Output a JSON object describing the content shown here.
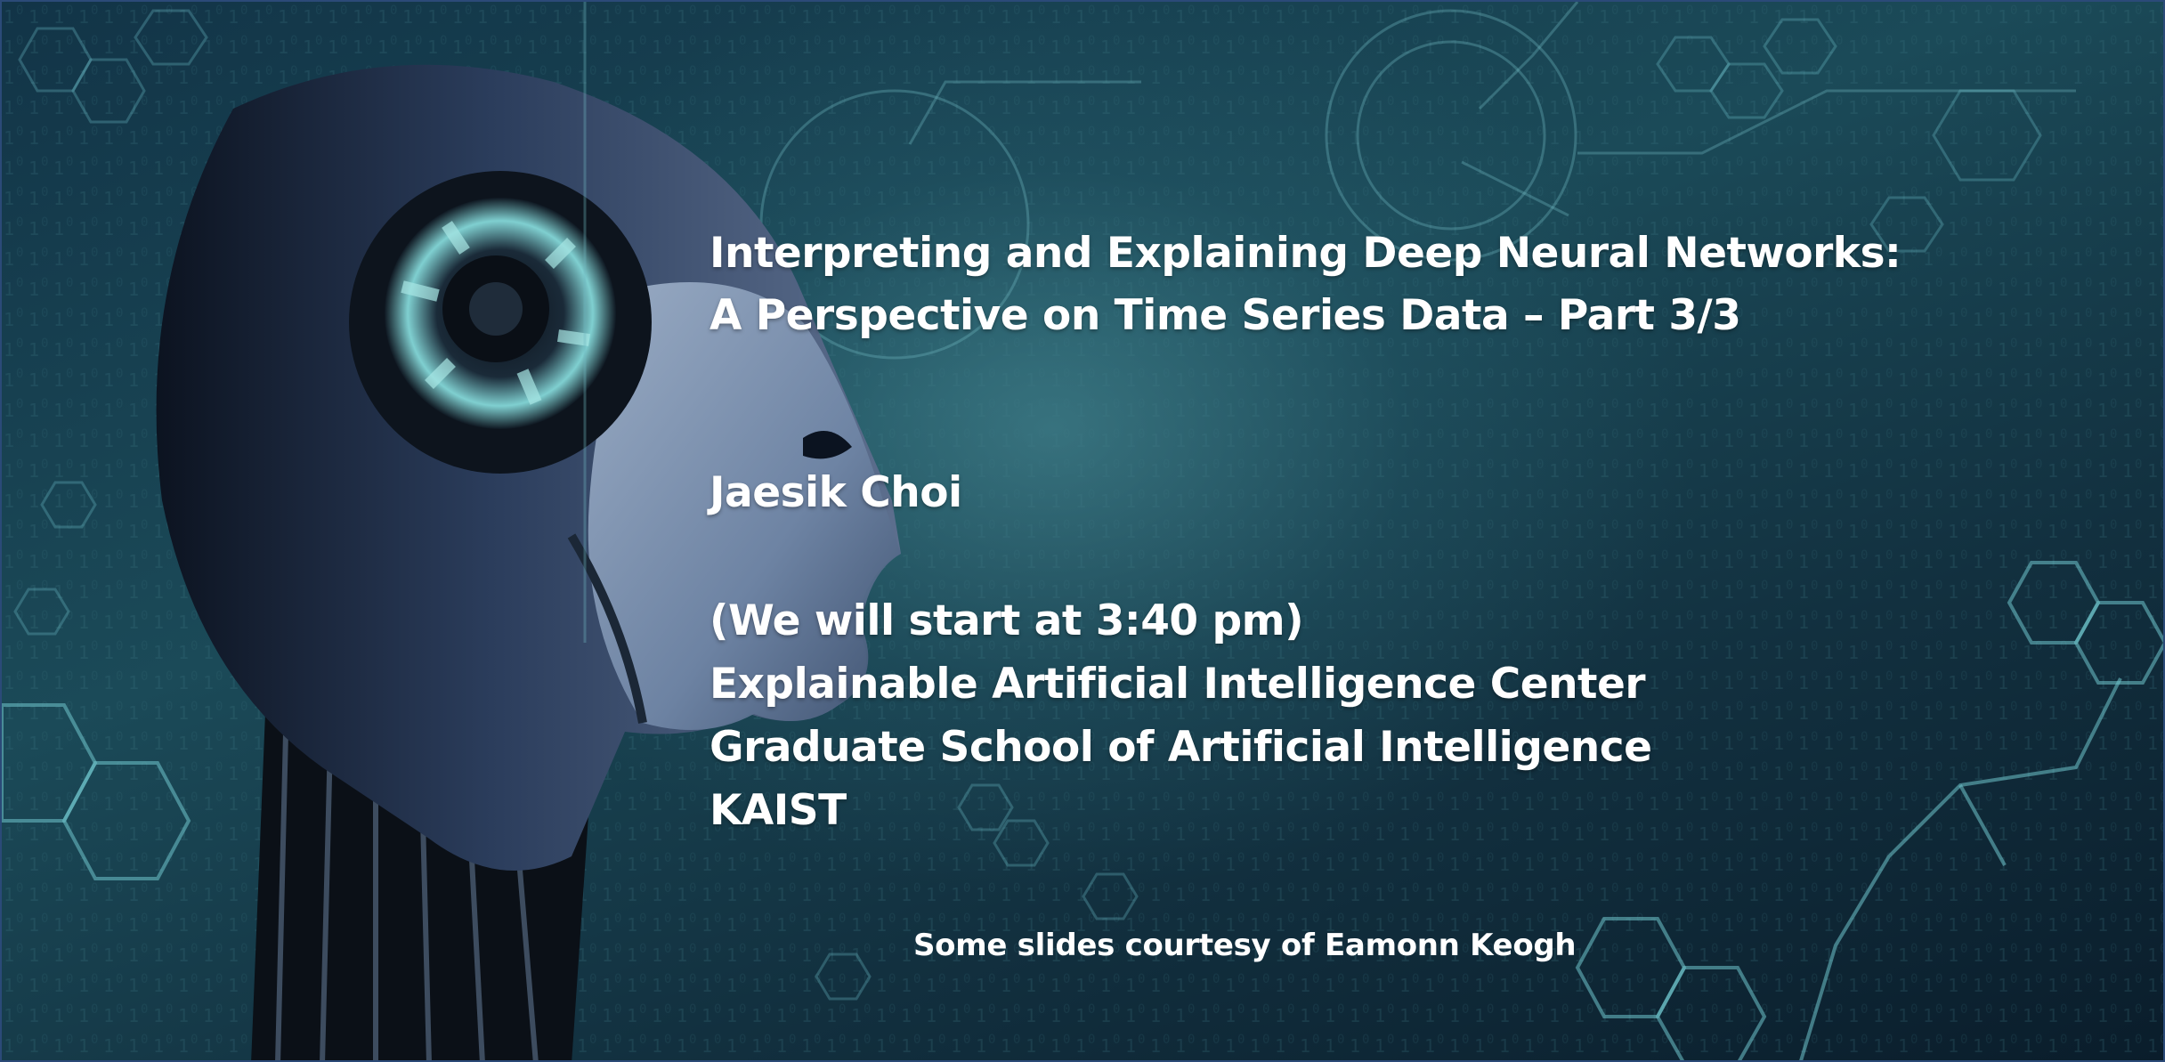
{
  "slide": {
    "title_line1": "Interpreting and Explaining Deep Neural Networks:",
    "title_line2": "A Perspective on Time Series Data – Part 3/3",
    "author": "Jaesik Choi",
    "start_note": "(We will start at 3:40 pm)",
    "affiliation_line1": "Explainable Artificial Intelligence Center",
    "affiliation_line2": "Graduate School of Artificial Intelligence",
    "affiliation_line3": "KAIST",
    "courtesy": "Some slides courtesy of Eamonn Keogh"
  },
  "background": {
    "image": "robot-head-profile",
    "pattern": "hexagon-circuit-binary",
    "colors": {
      "base": "#12303f",
      "glow": "#5a9ea6",
      "line": "#6fb8c0",
      "border": "#2b4a78"
    }
  }
}
